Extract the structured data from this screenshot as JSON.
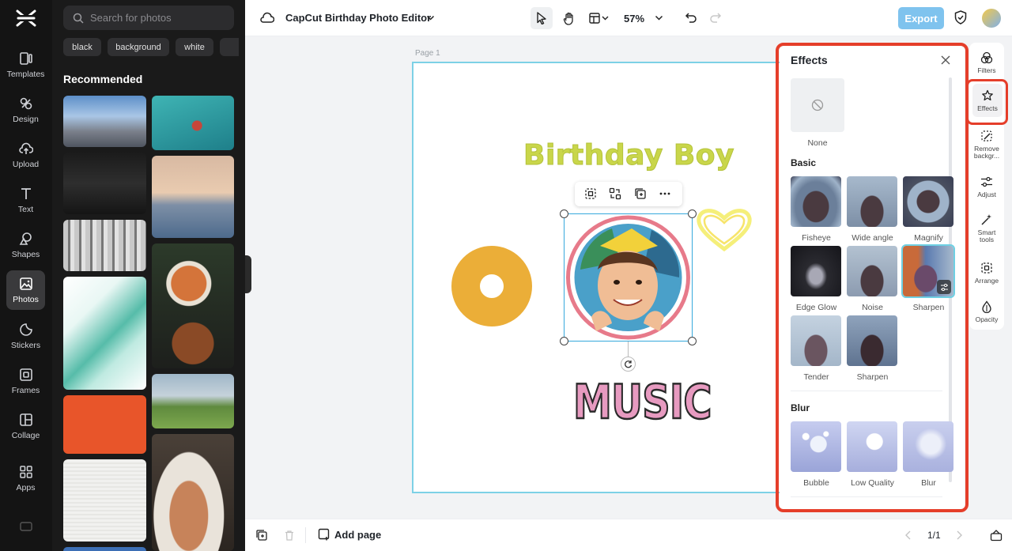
{
  "app": {
    "title": "CapCut Birthday Photo Editor"
  },
  "sidebar": {
    "items": [
      {
        "label": "Templates"
      },
      {
        "label": "Design"
      },
      {
        "label": "Upload"
      },
      {
        "label": "Text"
      },
      {
        "label": "Shapes"
      },
      {
        "label": "Photos"
      },
      {
        "label": "Stickers"
      },
      {
        "label": "Frames"
      },
      {
        "label": "Collage"
      },
      {
        "label": "Apps"
      }
    ],
    "active": "Photos"
  },
  "photos_panel": {
    "search_placeholder": "Search for photos",
    "chips": [
      "black",
      "background",
      "white"
    ],
    "section_title": "Recommended"
  },
  "toolbar": {
    "zoom": "57%",
    "export_label": "Export"
  },
  "canvas": {
    "page_label": "Page 1",
    "heading_text": "Birthday Boy",
    "music_text": "MUSIC"
  },
  "effects_panel": {
    "title": "Effects",
    "none_label": "None",
    "sections": {
      "basic": {
        "title": "Basic",
        "items": [
          "Fisheye",
          "Wide angle",
          "Magnify",
          "Edge Glow",
          "Noise",
          "Sharpen",
          "Tender",
          "Sharpen"
        ],
        "selected": "Sharpen"
      },
      "blur": {
        "title": "Blur",
        "items": [
          "Bubble",
          "Low Quality",
          "Blur"
        ]
      }
    }
  },
  "tool_rail": {
    "items": [
      {
        "label": "Filters"
      },
      {
        "label": "Effects"
      },
      {
        "label": "Remove backgr..."
      },
      {
        "label": "Adjust"
      },
      {
        "label": "Smart tools"
      },
      {
        "label": "Arrange"
      },
      {
        "label": "Opacity"
      }
    ],
    "active": "Effects"
  },
  "bottom_bar": {
    "add_page_label": "Add page",
    "page_indicator": "1/1"
  },
  "colors": {
    "accent": "#7fc3ee",
    "highlight": "#e53e2a",
    "selection": "#36a9dc"
  }
}
